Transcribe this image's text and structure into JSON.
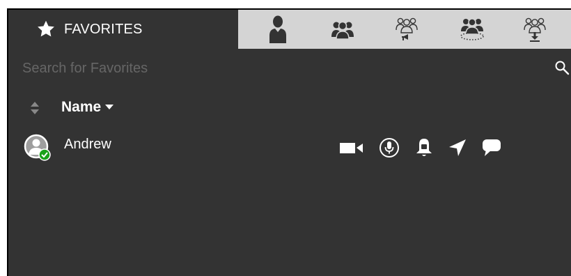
{
  "tabs": {
    "favorites_label": "FAVORITES",
    "icons": [
      "user-icon",
      "group-icon",
      "broadcast-group-icon",
      "dispatch-group-icon",
      "download-group-icon"
    ]
  },
  "search": {
    "placeholder": "Search for Favorites",
    "value": ""
  },
  "list_header": {
    "name_label": "Name"
  },
  "contacts": [
    {
      "name": "Andrew",
      "status": "online",
      "actions": [
        "video-icon",
        "microphone-icon",
        "bell-icon",
        "location-arrow-icon",
        "chat-icon"
      ]
    }
  ],
  "colors": {
    "background": "#333333",
    "tab_bar": "#d4d4d4",
    "status_online": "#1aa11a",
    "text": "#ffffff",
    "placeholder": "#666666"
  }
}
